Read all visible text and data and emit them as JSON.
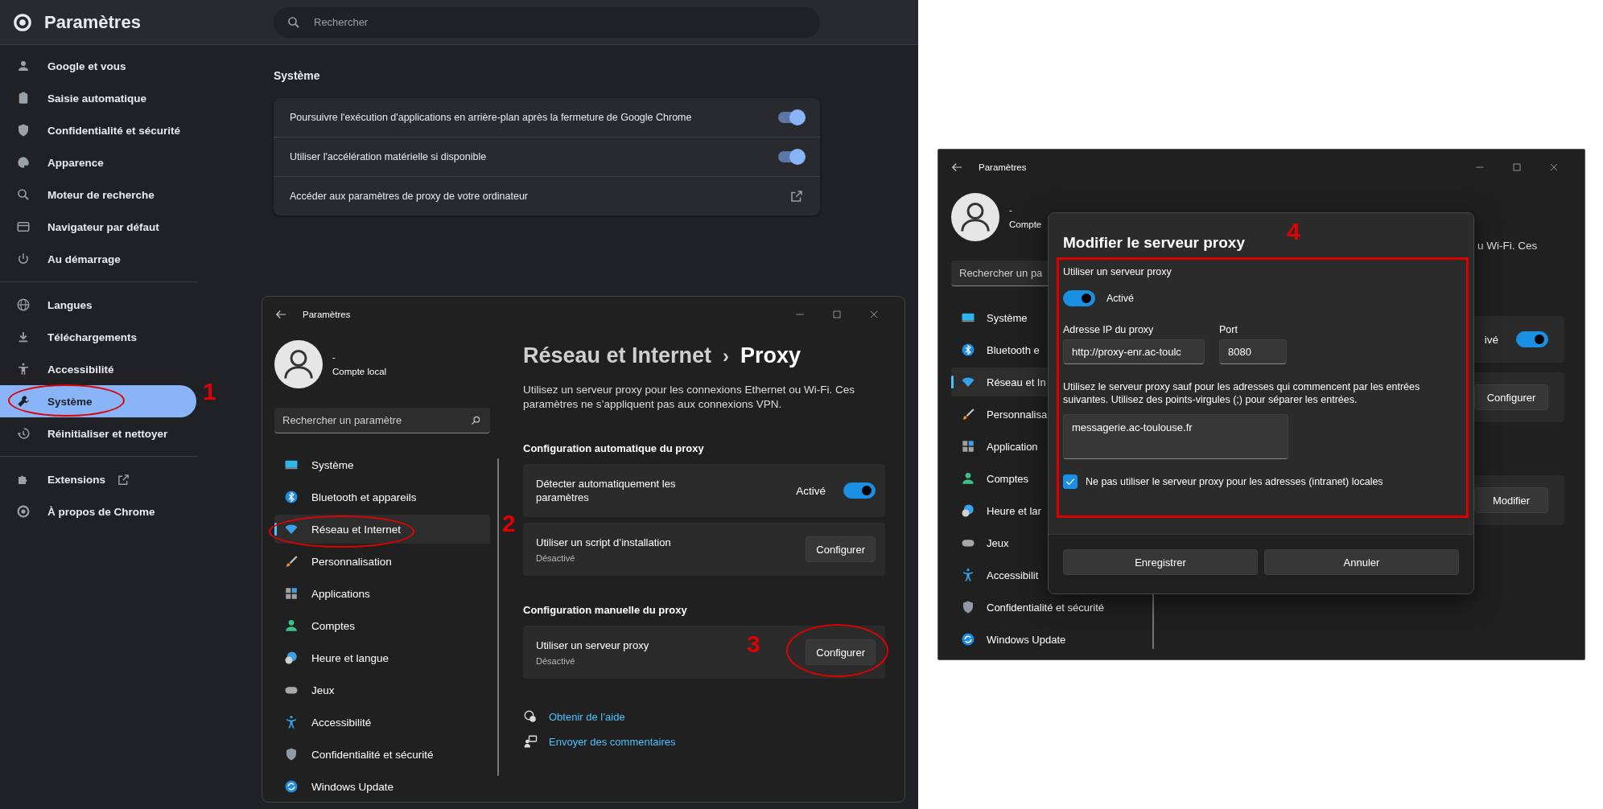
{
  "chrome": {
    "title": "Paramètres",
    "search": {
      "placeholder": "Rechercher"
    },
    "sidebar": [
      [
        {
          "label": "Google et vous",
          "selected": false,
          "external": false
        },
        {
          "label": "Saisie automatique",
          "selected": false,
          "external": false
        },
        {
          "label": "Confidentialité et sécurité",
          "selected": false,
          "external": false
        },
        {
          "label": "Apparence",
          "selected": false,
          "external": false
        },
        {
          "label": "Moteur de recherche",
          "selected": false,
          "external": false
        },
        {
          "label": "Navigateur par défaut",
          "selected": false,
          "external": false
        },
        {
          "label": "Au démarrage",
          "selected": false,
          "external": false
        }
      ],
      [
        {
          "label": "Langues",
          "selected": false,
          "external": false
        },
        {
          "label": "Téléchargements",
          "selected": false,
          "external": false
        },
        {
          "label": "Accessibilité",
          "selected": false,
          "external": false
        },
        {
          "label": "Système",
          "selected": true,
          "external": false
        },
        {
          "label": "Réinitialiser et nettoyer",
          "selected": false,
          "external": false
        }
      ],
      [
        {
          "label": "Extensions",
          "selected": false,
          "external": true
        },
        {
          "label": "À propos de Chrome",
          "selected": false,
          "external": false
        }
      ]
    ],
    "section_title": "Système",
    "settings": [
      {
        "kind": "toggle",
        "label": "Poursuivre l'exécution d'applications en arrière-plan après la fermeture de Google Chrome",
        "on": true
      },
      {
        "kind": "toggle",
        "label": "Utiliser l'accélération matérielle si disponible",
        "on": true
      },
      {
        "kind": "link",
        "label": "Accéder aux paramètres de proxy de votre ordinateur"
      }
    ]
  },
  "settings_window": {
    "title": "Paramètres",
    "account": {
      "name": "-",
      "type": "Compte local"
    },
    "search": {
      "placeholder": "Rechercher un paramètre"
    },
    "nav": [
      {
        "label": "Système",
        "selected": false
      },
      {
        "label": "Bluetooth et appareils",
        "selected": false
      },
      {
        "label": "Réseau et Internet",
        "selected": true
      },
      {
        "label": "Personnalisation",
        "selected": false
      },
      {
        "label": "Applications",
        "selected": false
      },
      {
        "label": "Comptes",
        "selected": false
      },
      {
        "label": "Heure et langue",
        "selected": false
      },
      {
        "label": "Jeux",
        "selected": false
      },
      {
        "label": "Accessibilité",
        "selected": false
      },
      {
        "label": "Confidentialité et sécurité",
        "selected": false
      },
      {
        "label": "Windows Update",
        "selected": false
      }
    ],
    "breadcrumb": {
      "parent": "Réseau et Internet",
      "separator": "›",
      "current": "Proxy"
    },
    "description": "Utilisez un serveur proxy pour les connexions Ethernet ou Wi-Fi. Ces paramètres ne s’appliquent pas aux connexions VPN.",
    "sections": [
      {
        "heading": "Configuration automatique du proxy",
        "rows": [
          {
            "kind": "toggle",
            "title": "Détecter automatiquement les paramètres",
            "state_label": "Activé",
            "on": true
          },
          {
            "kind": "button",
            "title": "Utiliser un script d’installation",
            "subtitle": "Désactivé",
            "button": "Configurer"
          }
        ]
      },
      {
        "heading": "Configuration manuelle du proxy",
        "rows": [
          {
            "kind": "button",
            "title": "Utiliser un serveur proxy",
            "subtitle": "Désactivé",
            "button": "Configurer"
          }
        ]
      }
    ],
    "links": [
      {
        "label": "Obtenir de l’aide"
      },
      {
        "label": "Envoyer des commentaires"
      }
    ]
  },
  "right_window": {
    "title": "Paramètres",
    "account": {
      "name": "-",
      "type": "Compte"
    },
    "search": {
      "placeholder": "Rechercher un pa"
    },
    "nav": [
      {
        "label": "Système",
        "selected": false
      },
      {
        "label": "Bluetooth e",
        "selected": false
      },
      {
        "label": "Réseau et In",
        "selected": true
      },
      {
        "label": "Personnalisa",
        "selected": false
      },
      {
        "label": "Application",
        "selected": false
      },
      {
        "label": "Comptes",
        "selected": false
      },
      {
        "label": "Heure et lar",
        "selected": false
      },
      {
        "label": "Jeux",
        "selected": false
      },
      {
        "label": "Accessibilit",
        "selected": false
      },
      {
        "label": "Confidentialité et sécurité",
        "selected": false
      },
      {
        "label": "Windows Update",
        "selected": false
      }
    ],
    "behind": {
      "description_tail": "u Wi-Fi. Ces",
      "toggle_label": "ivé",
      "toggle_on": true,
      "buttons": [
        "Configurer",
        "Modifier"
      ]
    },
    "dialog": {
      "title": "Modifier le serveur proxy",
      "toggle_title": "Utiliser un serveur proxy",
      "toggle_on": true,
      "toggle_label": "Activé",
      "ip_label": "Adresse IP du proxy",
      "ip_value": "http://proxy-enr.ac-toulc",
      "port_label": "Port",
      "port_value": "8080",
      "exceptions_text": "Utilisez le serveur proxy sauf pour les adresses qui commencent par les entrées suivantes. Utilisez des points-virgules (;) pour séparer les entrées.",
      "exceptions_value": "messagerie.ac-toulouse.fr",
      "local_label": "Ne pas utiliser le serveur proxy pour les adresses (intranet) locales",
      "local_checked": true,
      "buttons": [
        "Enregistrer",
        "Annuler"
      ]
    }
  },
  "annotations": [
    {
      "label": "1"
    },
    {
      "label": "2"
    },
    {
      "label": "3"
    },
    {
      "label": "4"
    }
  ]
}
